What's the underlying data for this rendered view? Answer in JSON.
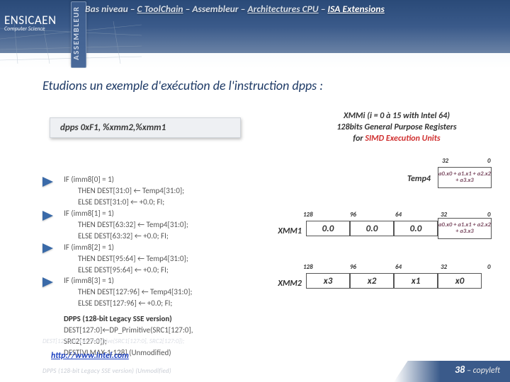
{
  "header": {
    "crumb1": "Bas niveau",
    "crumb2": "C ToolChain",
    "crumb3": "Assembleur",
    "crumb4": "Architectures CPU",
    "crumb5": "ISA Extensions"
  },
  "logo": {
    "name": "ENSICAEN",
    "sub": "Computer Science"
  },
  "sidebar_label": "ASSEMBLEUR",
  "title": "Etudions un exemple d'exécution de l'instruction dpps :",
  "code": "dpps   0xF1, %xmm2,%xmm1",
  "regs_desc": {
    "l1": "XMMi (i = 0 à 15 with Intel 64)",
    "l2": "128bits General Purpose Registers",
    "l3_pre": "for ",
    "l3_hl": "SIMD Execution Units"
  },
  "pseudo": {
    "p0": "IF (imm8[0] = 1)",
    "p0a": "THEN DEST[31:0] ← Temp4[31:0];",
    "p0b": "ELSE DEST[31:0] ← +0.0; FI;",
    "p1": "IF (imm8[1] = 1)",
    "p1a": "THEN DEST[63:32] ← Temp4[31:0];",
    "p1b": "ELSE DEST[63:32] ← +0.0; FI;",
    "p2": "IF (imm8[2] = 1)",
    "p2a": "THEN DEST[95:64] ← Temp4[31:0];",
    "p2b": "ELSE DEST[95:64] ← +0.0; FI;",
    "p3": "IF (imm8[3] = 1)",
    "p3a": "THEN DEST[127:96] ← Temp4[31:0];",
    "p3b": "ELSE DEST[127:96] ← +0.0; FI;",
    "dp_title": "DPPS (128-bit Legacy SSE version)",
    "dp1": "DEST[127:0]←DP_Primitive(SRC1[127:0], SRC2[127:0]);",
    "dp2": "DEST[VLMAX-1:128] (Unmodified)"
  },
  "link": "http://www.intel.com",
  "temp4": {
    "label": "Temp4",
    "bit32": "32",
    "bit0": "0",
    "val": "a0.x0 + a1.x1 + a2.x2 + a3.x3"
  },
  "xmm1": {
    "label": "XMM1",
    "b128": "128",
    "b96": "96",
    "b64": "64",
    "b32": "32",
    "b0": "0",
    "c3": "0.0",
    "c2": "0.0",
    "c1": "0.0",
    "c0": "a0.x0 + a1.x1 + a2.x2 + a3.x3"
  },
  "xmm2": {
    "label": "XMM2",
    "b128": "128",
    "b96": "96",
    "b64": "64",
    "b32": "32",
    "b0": "0",
    "c3": "x3",
    "c2": "x2",
    "c1": "x1",
    "c0": "x0"
  },
  "footer": {
    "page": "38",
    "note": " – copyleft"
  }
}
